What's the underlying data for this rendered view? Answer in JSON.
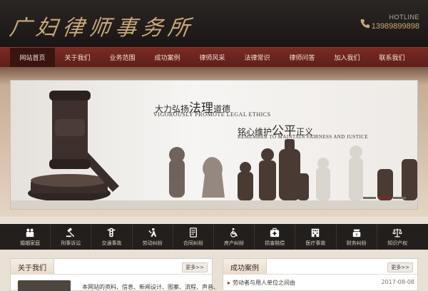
{
  "header": {
    "logo_text": "广妇律师事务所",
    "hotline_label": "HOTLINE",
    "hotline_number": "13989899898",
    "icon": "phone-icon"
  },
  "nav": {
    "items": [
      {
        "label": "网站首页",
        "active": true
      },
      {
        "label": "关于我们"
      },
      {
        "label": "业务范围"
      },
      {
        "label": "成功案例"
      },
      {
        "label": "律师风采"
      },
      {
        "label": "法律常识"
      },
      {
        "label": "律师问答"
      },
      {
        "label": "加入我们"
      },
      {
        "label": "联系我们"
      }
    ]
  },
  "banner": {
    "slogan1_pre": "大力弘扬",
    "slogan1_big": "法理",
    "slogan1_post": "道德",
    "slogan1_en": "VIGOROUSLY PROMOTE LEGAL ETHICS",
    "slogan2_pre": "铭心维护",
    "slogan2_big": "公平",
    "slogan2_post": "正义",
    "slogan2_en": "REMEMBER TO MAINTAIN FAIRNESS AND JUSTICE",
    "slides": 3,
    "active_slide": 2
  },
  "services": [
    {
      "label": "婚姻家庭",
      "icon": "family-icon"
    },
    {
      "label": "刑事诉讼",
      "icon": "gavel-icon"
    },
    {
      "label": "交通事故",
      "icon": "traffic-light-icon"
    },
    {
      "label": "劳动纠纷",
      "icon": "worker-icon"
    },
    {
      "label": "合同纠纷",
      "icon": "contract-icon"
    },
    {
      "label": "房产纠纷",
      "icon": "wheelchair-icon"
    },
    {
      "label": "损害赔偿",
      "icon": "medkit-icon"
    },
    {
      "label": "医疗事故",
      "icon": "hospital-icon"
    },
    {
      "label": "财务纠纷",
      "icon": "money-icon"
    },
    {
      "label": "知识产权",
      "icon": "scales-icon"
    }
  ],
  "about": {
    "title": "关于我们",
    "more": "更多>>",
    "text": "本网站的资料、信息、新闻设计、图案、流程、声音、"
  },
  "cases": {
    "title": "成功案例",
    "more": "更多>>",
    "items": [
      {
        "title": "劳动者与用人单位之间由",
        "date": "2017-08-08"
      }
    ]
  }
}
